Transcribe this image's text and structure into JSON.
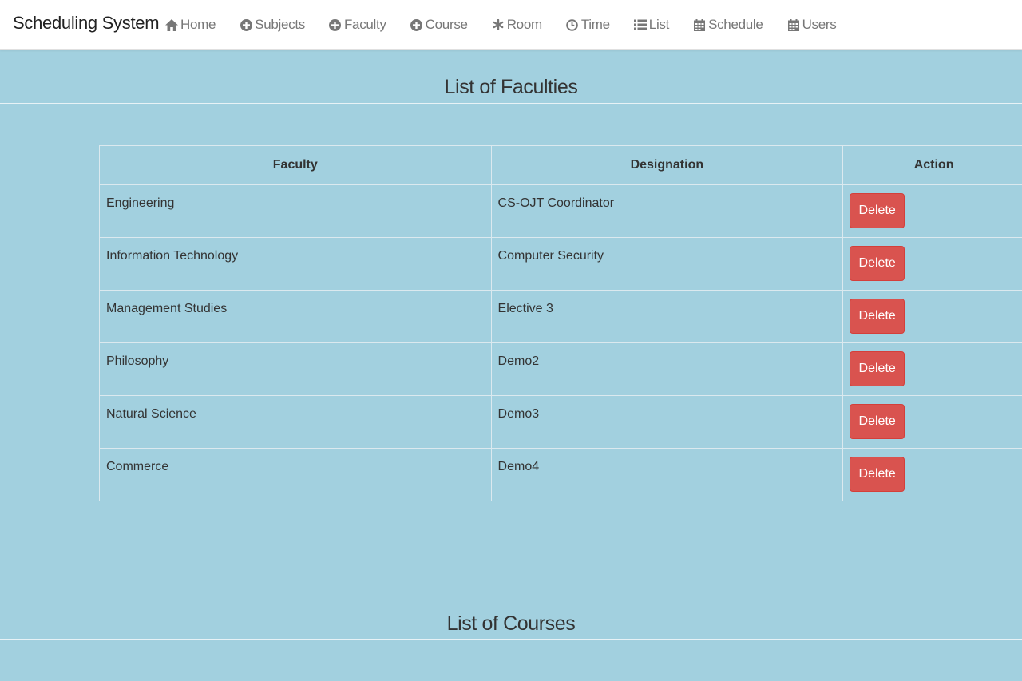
{
  "navbar": {
    "brand": "Scheduling System",
    "items": [
      {
        "label": "Home",
        "icon": "home-icon"
      },
      {
        "label": "Subjects",
        "icon": "plus-circle-icon"
      },
      {
        "label": "Faculty",
        "icon": "plus-circle-icon"
      },
      {
        "label": "Course",
        "icon": "plus-circle-icon"
      },
      {
        "label": "Room",
        "icon": "asterisk-icon"
      },
      {
        "label": "Time",
        "icon": "clock-icon"
      },
      {
        "label": "List",
        "icon": "list-icon"
      },
      {
        "label": "Schedule",
        "icon": "calendar-icon"
      },
      {
        "label": "Users",
        "icon": "calendar-icon"
      }
    ]
  },
  "faculties_section": {
    "title": "List of Faculties",
    "columns": [
      "Faculty",
      "Designation",
      "Action"
    ],
    "rows": [
      {
        "faculty": "Engineering",
        "designation": "CS-OJT Coordinator",
        "action": "Delete"
      },
      {
        "faculty": "Information Technology",
        "designation": "Computer Security",
        "action": "Delete"
      },
      {
        "faculty": "Management Studies",
        "designation": "Elective 3",
        "action": "Delete"
      },
      {
        "faculty": "Philosophy",
        "designation": "Demo2",
        "action": "Delete"
      },
      {
        "faculty": "Natural Science",
        "designation": "Demo3",
        "action": "Delete"
      },
      {
        "faculty": "Commerce",
        "designation": "Demo4",
        "action": "Delete"
      }
    ]
  },
  "courses_section": {
    "title": "List of Courses"
  },
  "colors": {
    "page_background": "#a2d0df",
    "delete_button": "#d9534f",
    "nav_text": "#777777"
  }
}
